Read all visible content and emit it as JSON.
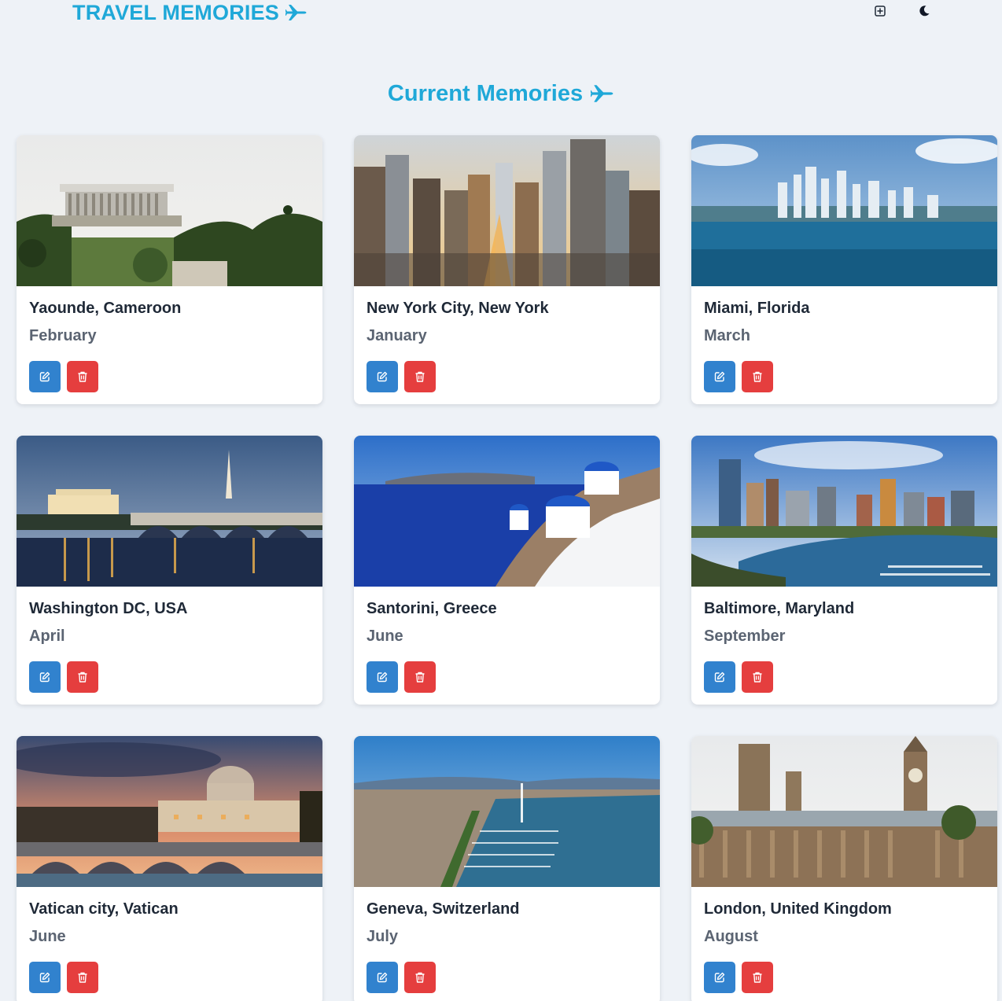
{
  "app": {
    "brand": "TRAVEL MEMORIES",
    "section_title": "Current Memories"
  },
  "colors": {
    "accent": "#1fa8d8",
    "edit": "#3182ce",
    "delete": "#e53e3e",
    "background": "#eef2f7"
  },
  "icons": {
    "brand": "airplane-icon",
    "add": "plus-square-icon",
    "theme": "moon-icon",
    "edit": "edit-icon",
    "delete": "trash-icon"
  },
  "memories": [
    {
      "place": "Yaounde, Cameroon",
      "month": "February"
    },
    {
      "place": "New York City, New York",
      "month": "January"
    },
    {
      "place": "Miami, Florida",
      "month": "March"
    },
    {
      "place": "Washington DC, USA",
      "month": "April"
    },
    {
      "place": "Santorini, Greece",
      "month": "June"
    },
    {
      "place": "Baltimore, Maryland",
      "month": "September"
    },
    {
      "place": "Vatican city, Vatican",
      "month": "June"
    },
    {
      "place": "Geneva, Switzerland",
      "month": "July"
    },
    {
      "place": "London, United Kingdom",
      "month": "August"
    }
  ]
}
